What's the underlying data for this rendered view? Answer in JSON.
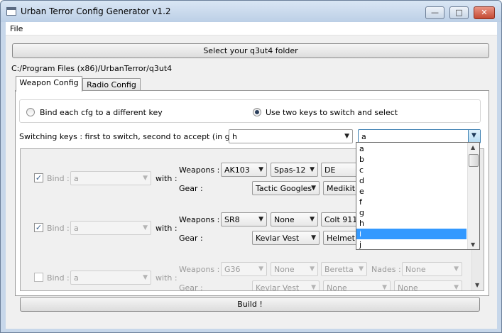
{
  "window": {
    "title": "Urban Terror Config Generator v1.2"
  },
  "menu": {
    "file": "File"
  },
  "select_folder_button": "Select your q3ut4 folder",
  "folder_path": "C:/Program Files (x86)/UrbanTerror/q3ut4",
  "tabs": [
    {
      "label": "Weapon Config",
      "active": true
    },
    {
      "label": "Radio Config",
      "active": false
    }
  ],
  "mode": {
    "option_bind": "Bind each cfg to a different key",
    "option_two_keys": "Use two keys to switch and select",
    "selected": "option_two_keys"
  },
  "switching": {
    "label": "Switching keys : first to switch, second to accept (in game):",
    "switch_key": "h",
    "accept_key": "a"
  },
  "key_dropdown": {
    "options": [
      "a",
      "b",
      "c",
      "d",
      "e",
      "f",
      "g",
      "h",
      "i",
      "j"
    ],
    "highlighted": "i"
  },
  "bind_rows": [
    {
      "checked": true,
      "enabled": true,
      "bind_label": "Bind :",
      "bind_key": "a",
      "with_label": "with :",
      "weapons_label": "Weapons :",
      "w1": "AK103",
      "w2": "Spas-12",
      "w3": "DE",
      "gear_label": "Gear :",
      "g1": "Tactic Googles",
      "g2": "Medikit"
    },
    {
      "checked": true,
      "enabled": true,
      "bind_label": "Bind :",
      "bind_key": "a",
      "with_label": "with :",
      "weapons_label": "Weapons :",
      "w1": "SR8",
      "w2": "None",
      "w3": "Colt 911",
      "gear_label": "Gear :",
      "g1": "Kevlar Vest",
      "g2": "Helmet"
    },
    {
      "checked": false,
      "enabled": false,
      "bind_label": "Bind :",
      "bind_key": "a",
      "with_label": "with :",
      "weapons_label": "Weapons :",
      "w1": "G36",
      "w2": "None",
      "w3": "Beretta",
      "nades_label": "Nades :",
      "nades": "None",
      "gear_label": "Gear :",
      "g1": "Kevlar Vest",
      "g2": "None",
      "g3": "None"
    }
  ],
  "build_button": "Build !",
  "colors": {
    "selection": "#3399ff",
    "titlebar": "#c7d7ea",
    "close_button": "#c44a34"
  }
}
